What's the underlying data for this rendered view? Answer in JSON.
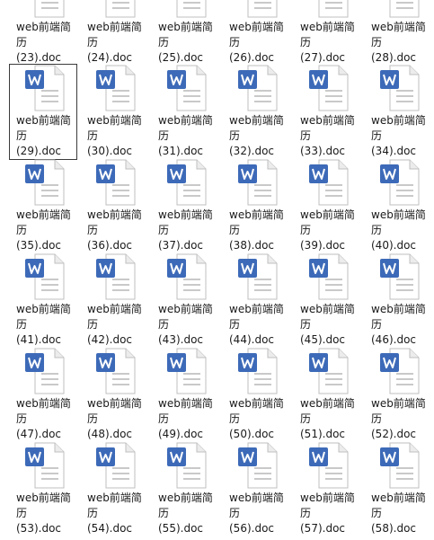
{
  "files": [
    {
      "name": "web前端简历\n(23).doc"
    },
    {
      "name": "web前端简历\n(24).doc"
    },
    {
      "name": "web前端简历\n(25).doc"
    },
    {
      "name": "web前端简历\n(26).doc"
    },
    {
      "name": "web前端简历\n(27).doc"
    },
    {
      "name": "web前端简历\n(28).doc"
    },
    {
      "name": "web前端简历\n(29).doc",
      "selected": true
    },
    {
      "name": "web前端简历\n(30).doc"
    },
    {
      "name": "web前端简历\n(31).doc"
    },
    {
      "name": "web前端简历\n(32).doc"
    },
    {
      "name": "web前端简历\n(33).doc"
    },
    {
      "name": "web前端简历\n(34).doc"
    },
    {
      "name": "web前端简历\n(35).doc"
    },
    {
      "name": "web前端简历\n(36).doc"
    },
    {
      "name": "web前端简历\n(37).doc"
    },
    {
      "name": "web前端简历\n(38).doc"
    },
    {
      "name": "web前端简历\n(39).doc"
    },
    {
      "name": "web前端简历\n(40).doc"
    },
    {
      "name": "web前端简历\n(41).doc"
    },
    {
      "name": "web前端简历\n(42).doc"
    },
    {
      "name": "web前端简历\n(43).doc"
    },
    {
      "name": "web前端简历\n(44).doc"
    },
    {
      "name": "web前端简历\n(45).doc"
    },
    {
      "name": "web前端简历\n(46).doc"
    },
    {
      "name": "web前端简历\n(47).doc"
    },
    {
      "name": "web前端简历\n(48).doc"
    },
    {
      "name": "web前端简历\n(49).doc"
    },
    {
      "name": "web前端简历\n(50).doc"
    },
    {
      "name": "web前端简历\n(51).doc"
    },
    {
      "name": "web前端简历\n(52).doc"
    },
    {
      "name": "web前端简历\n(53).doc"
    },
    {
      "name": "web前端简历\n(54).doc"
    },
    {
      "name": "web前端简历\n(55).doc"
    },
    {
      "name": "web前端简历\n(56).doc"
    },
    {
      "name": "web前端简历\n(57).doc"
    },
    {
      "name": "web前端简历\n(58).doc"
    }
  ],
  "icon": "word-document-icon",
  "colors": {
    "word_blue": "#3d6ab8",
    "page": "#ffffff",
    "fold": "#d0d0d0",
    "lines": "#c9c9c9"
  }
}
